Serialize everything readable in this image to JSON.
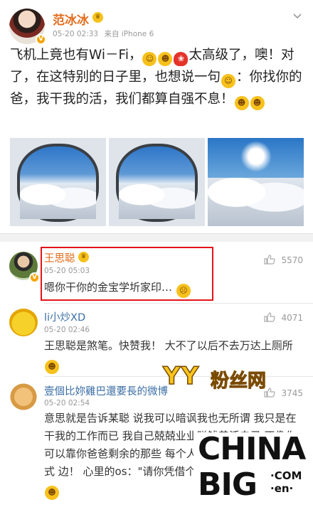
{
  "post": {
    "author": "范冰冰",
    "time": "05-20 02:33",
    "source": "来自 iPhone 6",
    "text_parts": [
      "飞机上竟也有Wi－Fi，",
      "太高级了，噢！对了，在这特别的日子里，也想说一句",
      "：你找你的爸，我干我的活，我们都算自强不息！"
    ],
    "photos": [
      "window-1",
      "window-2",
      "window-3"
    ]
  },
  "comments": [
    {
      "name": "王思聪",
      "time": "05-20 05:03",
      "text": "嗯你干你的金宝学圻家印…",
      "likes": "5570"
    },
    {
      "name": "li小炒XD",
      "time": "05-20 02:46",
      "text": "王思聪是煞笔。快赞我！ 大不了以后不去万达上厕所",
      "likes": "4071"
    },
    {
      "name": "壹個比妳雞巴還要長的微博",
      "time": "05-20 02:54",
      "text": "意思就是告诉某聪 说我可以暗讽我也无所谓 我只是在干我的工作而已 我自己兢兢业业赚钱养活自己 不像你可以靠你爸爸剩余的那些 每个人都有每个人的生存方式 边！ 心里的os：\"请你凭借个人 秀说，不然別bb\"",
      "likes": "3745"
    }
  ],
  "watermarks": {
    "yy": "YY",
    "fans": "粉丝网",
    "china": "CHINA",
    "big": "BIG",
    "com": "·COM",
    "cn": "·en·"
  },
  "colors": {
    "name_orange": "#e36d1c",
    "highlight_red": "#e3141b",
    "verified_gold": "#f6a500"
  }
}
